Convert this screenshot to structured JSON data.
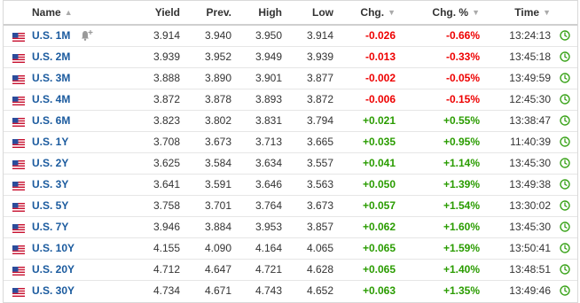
{
  "columns": {
    "name": "Name",
    "yield": "Yield",
    "prev": "Prev.",
    "high": "High",
    "low": "Low",
    "chg": "Chg.",
    "chg_pct": "Chg. %",
    "time": "Time"
  },
  "colors": {
    "negative": "#e00000",
    "positive": "#2a9c00",
    "name": "#1a5a9e"
  },
  "rows": [
    {
      "name": "U.S. 1M",
      "yield": "3.914",
      "prev": "3.940",
      "high": "3.950",
      "low": "3.914",
      "chg": "-0.026",
      "chg_pct": "-0.66%",
      "time": "13:24:13",
      "dir": "neg",
      "alert": true
    },
    {
      "name": "U.S. 2M",
      "yield": "3.939",
      "prev": "3.952",
      "high": "3.949",
      "low": "3.939",
      "chg": "-0.013",
      "chg_pct": "-0.33%",
      "time": "13:45:18",
      "dir": "neg"
    },
    {
      "name": "U.S. 3M",
      "yield": "3.888",
      "prev": "3.890",
      "high": "3.901",
      "low": "3.877",
      "chg": "-0.002",
      "chg_pct": "-0.05%",
      "time": "13:49:59",
      "dir": "neg"
    },
    {
      "name": "U.S. 4M",
      "yield": "3.872",
      "prev": "3.878",
      "high": "3.893",
      "low": "3.872",
      "chg": "-0.006",
      "chg_pct": "-0.15%",
      "time": "12:45:30",
      "dir": "neg"
    },
    {
      "name": "U.S. 6M",
      "yield": "3.823",
      "prev": "3.802",
      "high": "3.831",
      "low": "3.794",
      "chg": "+0.021",
      "chg_pct": "+0.55%",
      "time": "13:38:47",
      "dir": "pos"
    },
    {
      "name": "U.S. 1Y",
      "yield": "3.708",
      "prev": "3.673",
      "high": "3.713",
      "low": "3.665",
      "chg": "+0.035",
      "chg_pct": "+0.95%",
      "time": "11:40:39",
      "dir": "pos"
    },
    {
      "name": "U.S. 2Y",
      "yield": "3.625",
      "prev": "3.584",
      "high": "3.634",
      "low": "3.557",
      "chg": "+0.041",
      "chg_pct": "+1.14%",
      "time": "13:45:30",
      "dir": "pos"
    },
    {
      "name": "U.S. 3Y",
      "yield": "3.641",
      "prev": "3.591",
      "high": "3.646",
      "low": "3.563",
      "chg": "+0.050",
      "chg_pct": "+1.39%",
      "time": "13:49:38",
      "dir": "pos"
    },
    {
      "name": "U.S. 5Y",
      "yield": "3.758",
      "prev": "3.701",
      "high": "3.764",
      "low": "3.673",
      "chg": "+0.057",
      "chg_pct": "+1.54%",
      "time": "13:30:02",
      "dir": "pos"
    },
    {
      "name": "U.S. 7Y",
      "yield": "3.946",
      "prev": "3.884",
      "high": "3.953",
      "low": "3.857",
      "chg": "+0.062",
      "chg_pct": "+1.60%",
      "time": "13:45:30",
      "dir": "pos"
    },
    {
      "name": "U.S. 10Y",
      "yield": "4.155",
      "prev": "4.090",
      "high": "4.164",
      "low": "4.065",
      "chg": "+0.065",
      "chg_pct": "+1.59%",
      "time": "13:50:41",
      "dir": "pos"
    },
    {
      "name": "U.S. 20Y",
      "yield": "4.712",
      "prev": "4.647",
      "high": "4.721",
      "low": "4.628",
      "chg": "+0.065",
      "chg_pct": "+1.40%",
      "time": "13:48:51",
      "dir": "pos"
    },
    {
      "name": "U.S. 30Y",
      "yield": "4.734",
      "prev": "4.671",
      "high": "4.743",
      "low": "4.652",
      "chg": "+0.063",
      "chg_pct": "+1.35%",
      "time": "13:49:46",
      "dir": "pos"
    }
  ]
}
